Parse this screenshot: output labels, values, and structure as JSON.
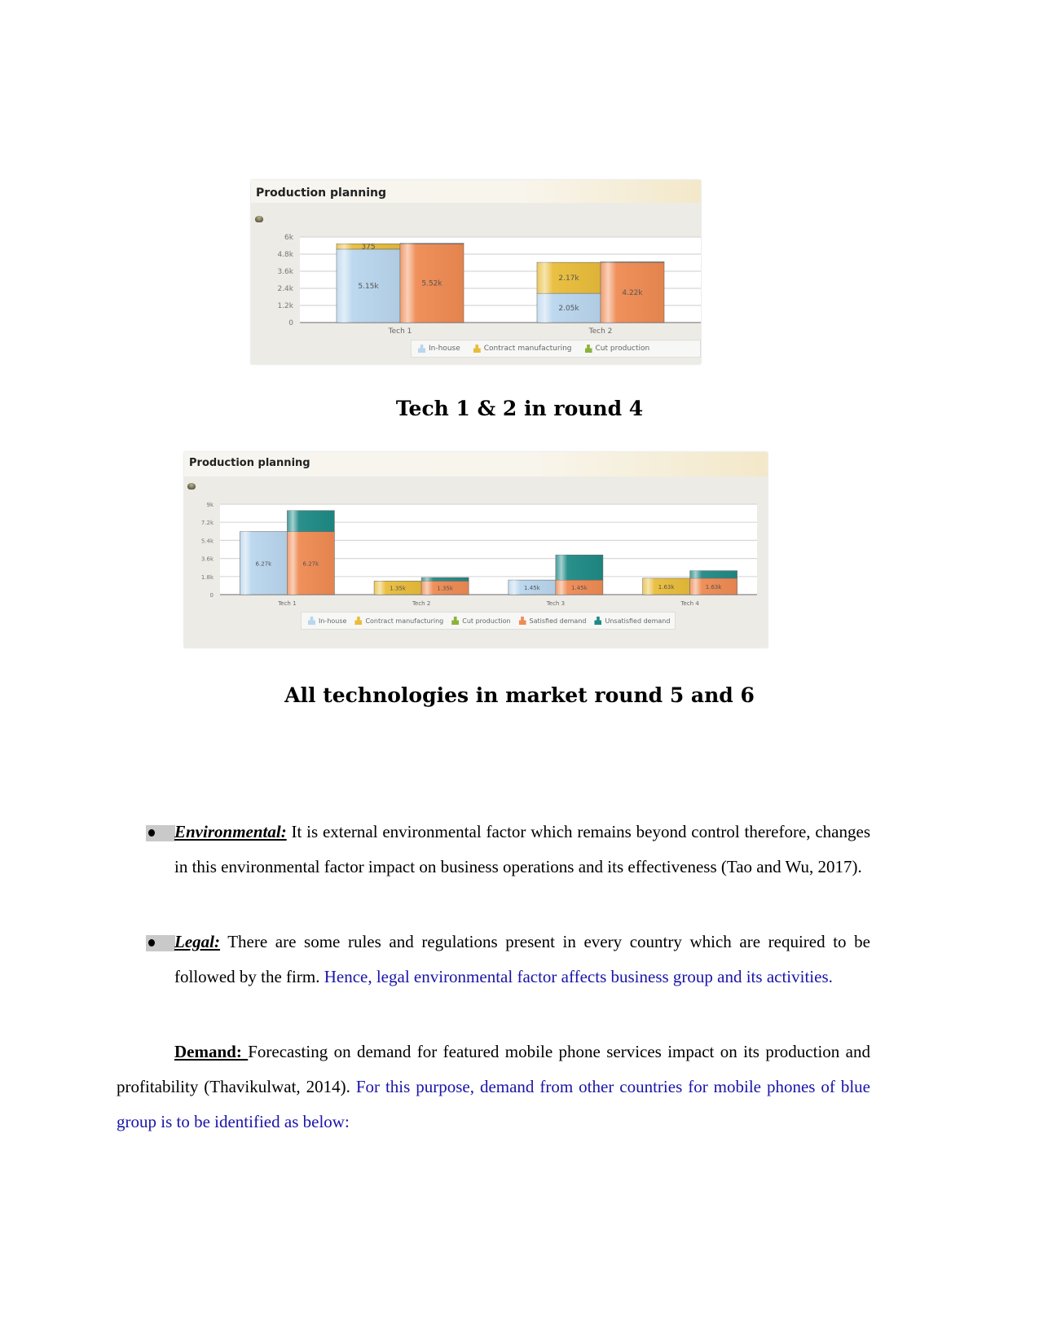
{
  "chart_data": [
    {
      "type": "bar",
      "stacked_groups": true,
      "title": "Production planning",
      "caption": "Tech 1 & 2 in round 4",
      "categories": [
        "Tech 1",
        "Tech 2"
      ],
      "ylim": [
        0,
        6000
      ],
      "yticks": [
        "0",
        "1.2k",
        "2.4k",
        "3.6k",
        "4.8k",
        "6k"
      ],
      "ytick_values": [
        0,
        1200,
        2400,
        3600,
        4800,
        6000
      ],
      "grid": true,
      "legend_position": "bottom-right",
      "legend": [
        "In-house",
        "Contract manufacturing",
        "Cut production"
      ],
      "stacks": {
        "production": [
          {
            "name": "In-house",
            "values": [
              5150,
              2050
            ],
            "labels": [
              "5.15k",
              "2.05k"
            ]
          },
          {
            "name": "Contract manufacturing",
            "values": [
              375,
              2170
            ],
            "labels": [
              "375",
              "2.17k"
            ]
          }
        ],
        "demand": [
          {
            "name": "Satisfied demand",
            "values": [
              5520,
              4220
            ],
            "labels": [
              "5.52k",
              "4.22k"
            ]
          },
          {
            "name": "Unsatisfied demand",
            "values": [
              40,
              40
            ],
            "labels": [
              "",
              ""
            ]
          }
        ]
      }
    },
    {
      "type": "bar",
      "stacked_groups": true,
      "title": "Production planning",
      "caption": "All technologies in market round 5 and 6",
      "categories": [
        "Tech 1",
        "Tech 2",
        "Tech 3",
        "Tech 4"
      ],
      "ylim": [
        0,
        9000
      ],
      "yticks": [
        "0",
        "1.8k",
        "3.6k",
        "5.4k",
        "7.2k",
        "9k"
      ],
      "ytick_values": [
        0,
        1800,
        3600,
        5400,
        7200,
        9000
      ],
      "grid": true,
      "legend_position": "bottom",
      "legend": [
        "In-house",
        "Contract manufacturing",
        "Cut production",
        "Satisfied demand",
        "Unsatisfied demand"
      ],
      "stacks": {
        "production": [
          {
            "name": "In-house",
            "values": [
              6270,
              0,
              1450,
              0
            ],
            "labels": [
              "6.27k",
              "",
              "1.45k",
              ""
            ]
          },
          {
            "name": "Contract manufacturing",
            "values": [
              0,
              1350,
              0,
              1630
            ],
            "labels": [
              "",
              "1.35k",
              "",
              "1.63k"
            ]
          }
        ],
        "demand": [
          {
            "name": "Satisfied demand",
            "values": [
              6270,
              1350,
              1450,
              1630
            ],
            "labels": [
              "6.27k",
              "1.35k",
              "1.45k",
              "1.63k"
            ]
          },
          {
            "name": "Unsatisfied demand",
            "values": [
              2100,
              350,
              2500,
              750
            ],
            "labels": [
              "",
              "",
              "",
              ""
            ]
          }
        ]
      }
    }
  ],
  "colors": {
    "in_house": "#b9d6ee",
    "contract": "#e9bd3a",
    "cut": "#8ab33a",
    "satisfied": "#ef8a52",
    "unsatisfied": "#1f8a86",
    "link_blue": "#1a14a8"
  },
  "body": {
    "environmental": {
      "keyword": "Environmental:",
      "text": " It is external environmental factor which remains beyond control therefore, changes in this environmental factor impact on business operations and its effectiveness (Tao and Wu, 2017)."
    },
    "legal": {
      "keyword": "Legal:",
      "text": " There are some rules and regulations present in every country which are required to be followed by the firm. ",
      "blue_text": "Hence, legal environmental factor affects business group and its activities."
    },
    "demand": {
      "keyword": "Demand: ",
      "text": "Forecasting on demand for featured mobile phone services impact on its production and profitability (Thavikulwat, 2014). ",
      "blue_text": "For this purpose, demand from other countries for mobile phones of blue group is to be identified as below:"
    }
  }
}
